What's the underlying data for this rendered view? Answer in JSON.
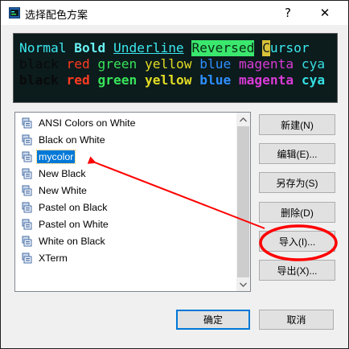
{
  "window": {
    "title": "选择配色方案",
    "help_label": "?",
    "close_label": "✕"
  },
  "preview": {
    "line1": {
      "normal": "Normal",
      "bold": "Bold",
      "underline": "Underline",
      "reversed": "Reversed",
      "cursor_char": "C",
      "cursor_rest": "ursor"
    },
    "line2": {
      "black": "black",
      "red": "red",
      "green": "green",
      "yellow": "yellow",
      "blue": "blue",
      "magenta": "magenta",
      "cyan": "cya"
    },
    "line3": {
      "black": "black",
      "red": "red",
      "green": "green",
      "yellow": "yellow",
      "blue": "blue",
      "magenta": "magenta",
      "cyan": "cya"
    }
  },
  "schemes": {
    "items": [
      {
        "label": "ANSI Colors on White"
      },
      {
        "label": "Black on White"
      },
      {
        "label": "mycolor"
      },
      {
        "label": "New Black"
      },
      {
        "label": "New White"
      },
      {
        "label": "Pastel on Black"
      },
      {
        "label": "Pastel on White"
      },
      {
        "label": "White on Black"
      },
      {
        "label": "XTerm"
      }
    ],
    "selected": "mycolor"
  },
  "buttons": {
    "new": "新建(N)",
    "edit": "编辑(E)...",
    "save_as": "另存为(S)",
    "delete": "删除(D)",
    "import": "导入(I)...",
    "export": "导出(X)...",
    "ok": "确定",
    "cancel": "取消"
  },
  "colors": {
    "selection": "#0078d7",
    "annotation": "#ff0000",
    "terminal_background": "#0c1b1c"
  }
}
